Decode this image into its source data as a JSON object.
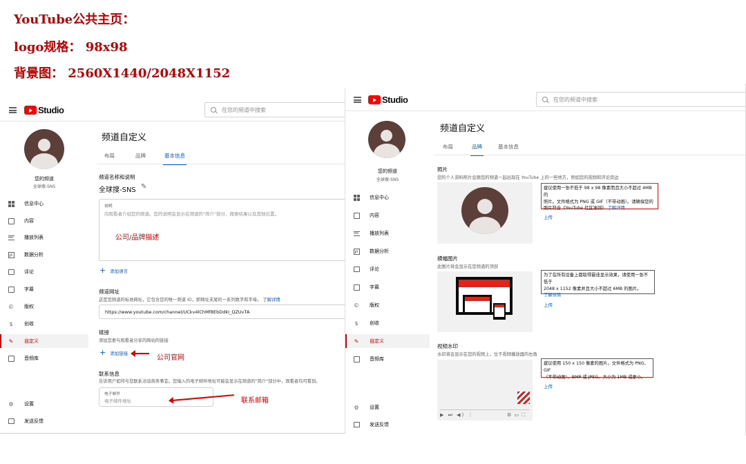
{
  "header": {
    "line1": "YouTube公共主页：",
    "line2": "logo规格： 98x98",
    "line3": "背景图： 2560X1440/2048X1152"
  },
  "app": {
    "logo_text": "Studio",
    "search_placeholder": "在您的频道中搜索"
  },
  "sidebar": {
    "channel_title": "您的频道",
    "channel_name": "全球搜-SNS",
    "items": [
      {
        "label": "信息中心",
        "icon": "dashboard-icon"
      },
      {
        "label": "内容",
        "icon": "content-icon"
      },
      {
        "label": "播放列表",
        "icon": "playlist-icon"
      },
      {
        "label": "数据分析",
        "icon": "analytics-icon"
      },
      {
        "label": "评论",
        "icon": "comments-icon"
      },
      {
        "label": "字幕",
        "icon": "subtitles-icon"
      },
      {
        "label": "版权",
        "icon": "copyright-icon"
      },
      {
        "label": "创收",
        "icon": "dollar-icon"
      },
      {
        "label": "自定义",
        "icon": "wand-icon"
      },
      {
        "label": "音频库",
        "icon": "audio-library-icon"
      }
    ],
    "settings": "设置",
    "feedback": "发送反馈"
  },
  "page": {
    "title": "频道自定义",
    "tabs": [
      "布局",
      "品牌",
      "基本信息"
    ]
  },
  "left": {
    "name_section": "频道名称和说明",
    "channel_name": "全球搜-SNS",
    "desc_label": "说明",
    "desc_placeholder": "向观看者介绍您的频道。您的说明会显示在频道的\"简介\"部分、搜索结果以及其他位置。",
    "desc_note": "公司/品牌描述",
    "add_language": "添加语言",
    "url_section": "频道网址",
    "url_desc": "这是您频道的标准网址，它包含您的唯一频道 ID，即网址末尾的一系列数字和字母。",
    "url_learn_more": "了解详情",
    "url_value": "https://www.youtube.com/channel/UCkv4lChMf8EbDdkI_QZUvTA",
    "links_section": "链接",
    "links_desc": "添加您要与观看者分享的网站的链接",
    "add_link": "添加链接",
    "links_note": "公司官网",
    "contact_section": "联系信息",
    "contact_desc": "告诉用户如何与您联系洽谈商务事宜。您输入的电子邮件地址可能会显示在频道的\"简介\"部分中，观看者均可看到。",
    "email_label": "电子邮件",
    "email_placeholder": "电子邮件地址",
    "email_note": "联系邮箱"
  },
  "right": {
    "photo_section": "照片",
    "photo_desc": "您的个人资料照片会随您的频道一起出现在 YouTube 上的一些地方，例如您的视频和评论旁边",
    "photo_hint_1": "建议使用一张不低于 98 x 98 像素而且大小不超过 4MB 的",
    "photo_hint_2": "照片。文件格式为 PNG 或 GIF（不带动画）。请确保您的",
    "photo_hint_3": "照片符合《YouTube 社区准则》",
    "photo_hint_link": "了解详情",
    "upload": "上传",
    "banner_section": "横幅图片",
    "banner_desc": "此图片将会显示在您频道的顶部",
    "banner_hint_1": "为了在所有设备上都取得最佳显示效果，请使用一张不低于",
    "banner_hint_2": "2048 x 1152 像素并且大小不超过 6MB 的图片。",
    "banner_hint_link": "了解详情",
    "watermark_section": "视频水印",
    "watermark_desc": "水印将会显示在您的视频上，位于视频播放器的右角",
    "watermark_hint_1": "建议使用 150 x 150 像素的图片。文件格式为 PNG、GIF",
    "watermark_hint_2": "（不带动画）、BMP 或 JPEG。大小为 1MB 或更小。",
    "player_controls": "▶ ⏭ ◀) ⋮",
    "player_right": "⚙ ▭ ⛶"
  },
  "colors": {
    "annotation_red": "#e00000",
    "youtube_red": "#ff0000",
    "link_blue": "#065fd4"
  }
}
